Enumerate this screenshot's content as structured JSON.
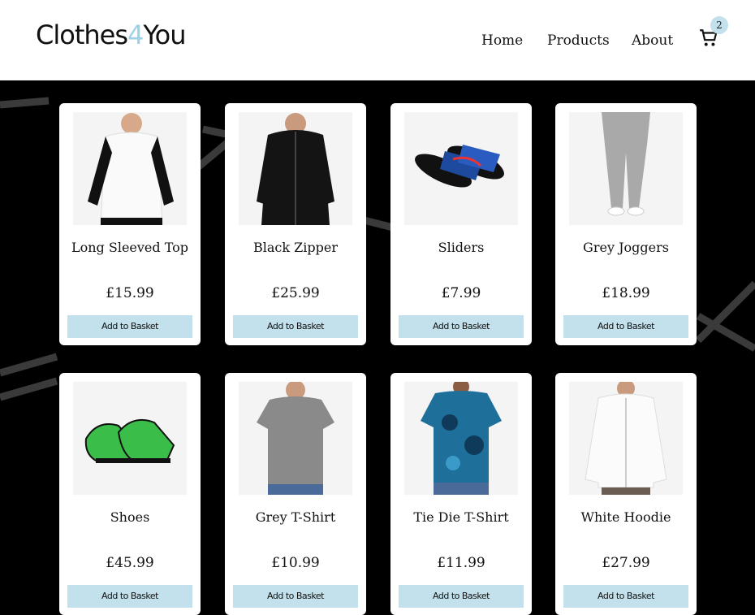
{
  "brand": {
    "pre": "Clothes",
    "four": "4",
    "post": "You"
  },
  "nav": {
    "home": "Home",
    "products": "Products",
    "about": "About"
  },
  "cart": {
    "count": "2"
  },
  "colors": {
    "accent": "#c3e1ec",
    "background": "#000000",
    "card": "#ffffff"
  },
  "products": [
    {
      "name": "Long Sleeved Top",
      "price": "£15.99",
      "button": "Add to Basket",
      "icon": "long-sleeved-top-image"
    },
    {
      "name": "Black Zipper",
      "price": "£25.99",
      "button": "Add to Basket",
      "icon": "black-zipper-image"
    },
    {
      "name": "Sliders",
      "price": "£7.99",
      "button": "Add to Basket",
      "icon": "sliders-image"
    },
    {
      "name": "Grey Joggers",
      "price": "£18.99",
      "button": "Add to Basket",
      "icon": "grey-joggers-image"
    },
    {
      "name": "Shoes",
      "price": "£45.99",
      "button": "Add to Basket",
      "icon": "shoes-image"
    },
    {
      "name": "Grey T-Shirt",
      "price": "£10.99",
      "button": "Add to Basket",
      "icon": "grey-tshirt-image"
    },
    {
      "name": "Tie Die T-Shirt",
      "price": "£11.99",
      "button": "Add to Basket",
      "icon": "tie-die-tshirt-image"
    },
    {
      "name": "White Hoodie",
      "price": "£27.99",
      "button": "Add to Basket",
      "icon": "white-hoodie-image"
    }
  ]
}
